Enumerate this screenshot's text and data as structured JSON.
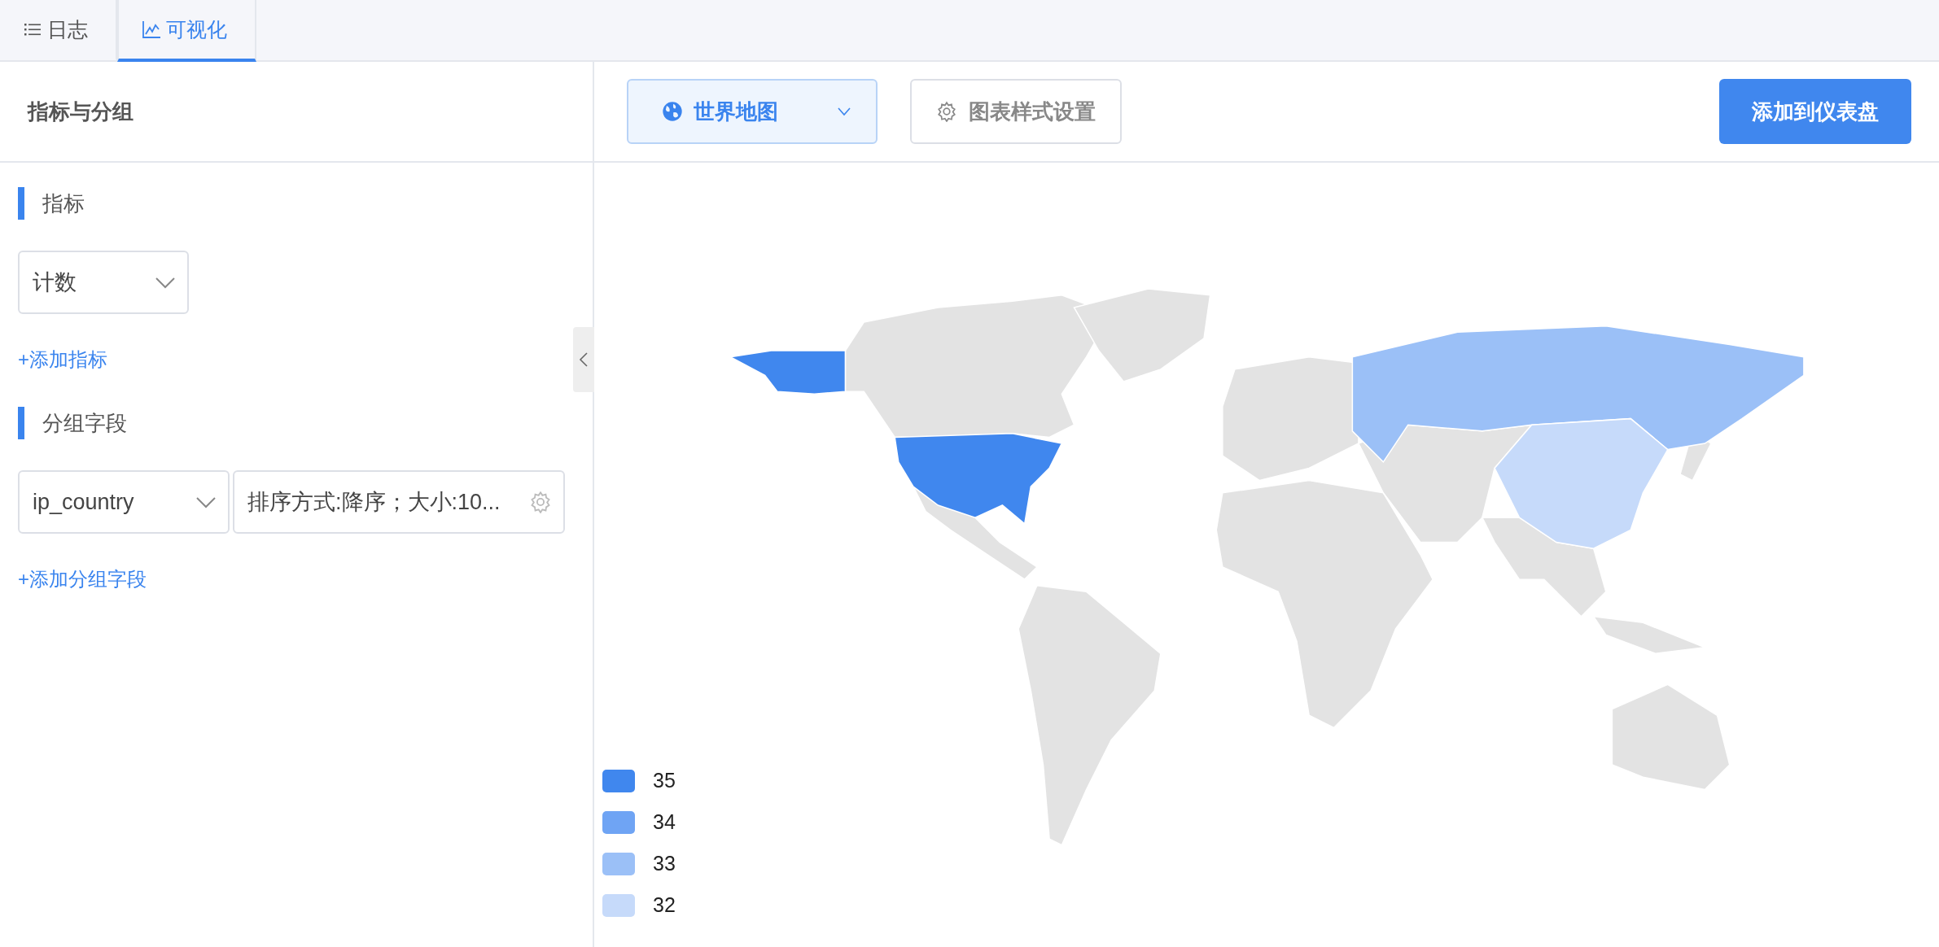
{
  "tabs": [
    {
      "label": "日志",
      "kind": "list",
      "selected": false
    },
    {
      "label": "可视化",
      "kind": "chart",
      "selected": true
    }
  ],
  "panel": {
    "title": "指标与分组",
    "sections": [
      {
        "kind": "metric",
        "title": "指标",
        "select": "计数",
        "add_link": "+添加指标"
      },
      {
        "kind": "group",
        "title": "分组字段",
        "select": "ip_country",
        "settings": "排序方式:降序；大小:10...",
        "add_link": "+添加分组字段"
      }
    ]
  },
  "toolbar": {
    "chart_type": "世界地图",
    "style_button": "图表样式设置",
    "add_button": "添加到仪表盘"
  },
  "legend": [
    {
      "label": "35",
      "color": "#4087ee"
    },
    {
      "label": "34",
      "color": "#6fa4f4"
    },
    {
      "label": "33",
      "color": "#9bc0f7"
    },
    {
      "label": "32",
      "color": "#c6dafa"
    }
  ]
}
